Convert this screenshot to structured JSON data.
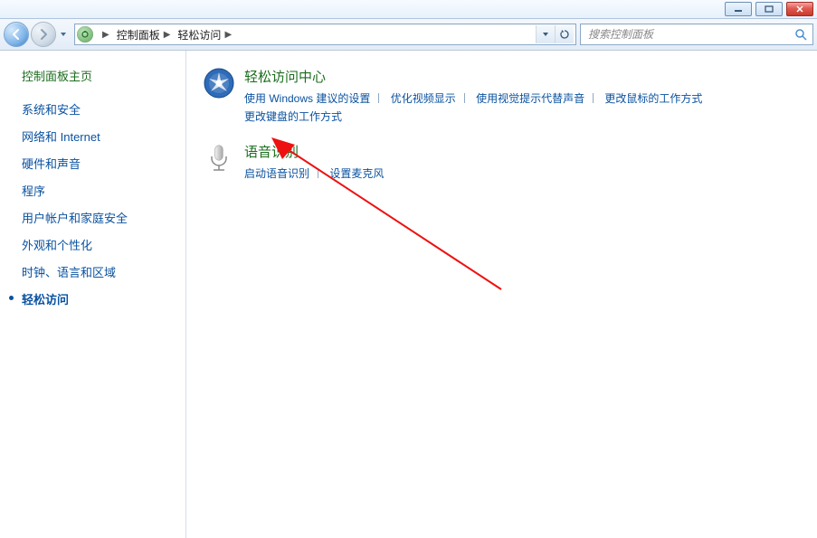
{
  "search": {
    "placeholder": "搜索控制面板"
  },
  "breadcrumb": {
    "items": [
      {
        "label": "控制面板"
      },
      {
        "label": "轻松访问"
      }
    ]
  },
  "sidebar": {
    "home_label": "控制面板主页",
    "items": [
      {
        "label": "系统和安全",
        "active": false
      },
      {
        "label": "网络和 Internet",
        "active": false
      },
      {
        "label": "硬件和声音",
        "active": false
      },
      {
        "label": "程序",
        "active": false
      },
      {
        "label": "用户帐户和家庭安全",
        "active": false
      },
      {
        "label": "外观和个性化",
        "active": false
      },
      {
        "label": "时钟、语言和区域",
        "active": false
      },
      {
        "label": "轻松访问",
        "active": true
      }
    ]
  },
  "main": {
    "categories": [
      {
        "title": "轻松访问中心",
        "links": [
          "使用 Windows 建议的设置",
          "优化视频显示",
          "使用视觉提示代替声音",
          "更改鼠标的工作方式",
          "更改键盘的工作方式"
        ]
      },
      {
        "title": "语音识别",
        "links": [
          "启动语音识别",
          "设置麦克风"
        ]
      }
    ]
  }
}
